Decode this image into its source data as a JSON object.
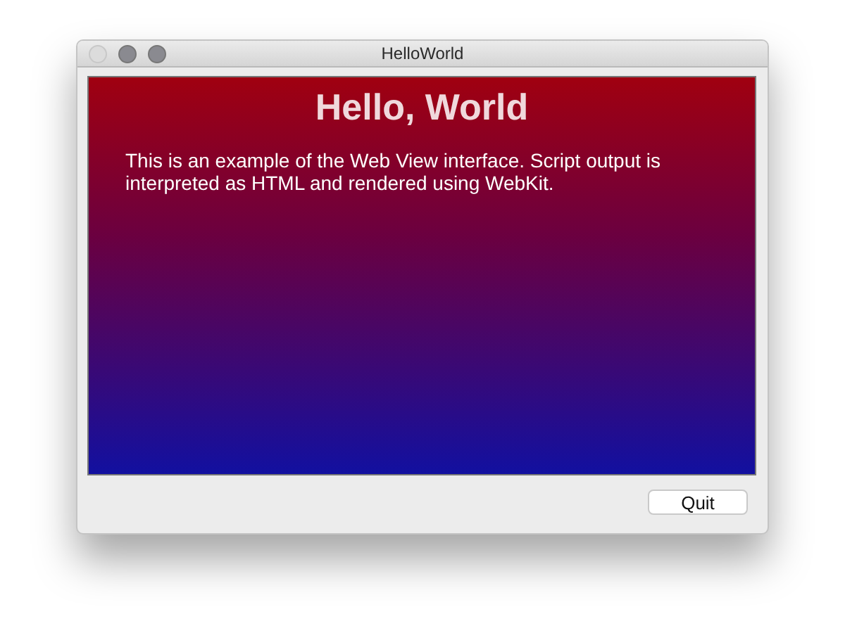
{
  "window": {
    "title": "HelloWorld",
    "title_buttons": [
      {
        "disabled": true
      },
      {
        "disabled": false
      },
      {
        "disabled": false
      }
    ]
  },
  "web_view": {
    "heading": "Hello, World",
    "body": "This is an example of the Web View interface. Script output is interpreted as HTML and rendered using WebKit."
  },
  "buttons": [
    "Quit"
  ]
}
